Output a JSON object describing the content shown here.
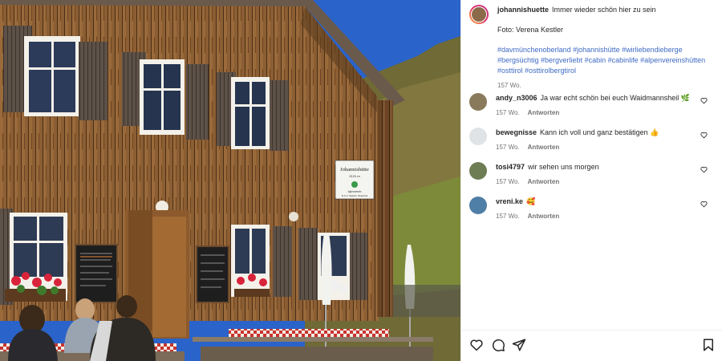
{
  "post": {
    "author": "johannishuette",
    "caption": "Immer wieder schön hier zu sein",
    "photo_credit": "Foto: Verena Kestler",
    "hashtags": "#davmünchenoberland #johannishütte #wirliebendieberge #bergsüchtig #bergverliebt #cabin #cabinlife #alpenvereinshütten #osttirol #osttirolbergtirol",
    "age": "157 Wo."
  },
  "photo": {
    "sign_title": "Johannishütte",
    "sign_subtitle": "2121 m",
    "sign_line1": "Alpenverein",
    "sign_line2": "D.A.V. Sektion Oberland"
  },
  "comments": [
    {
      "user": "andy_n3006",
      "text": "Ja war echt schön bei euch Waidmannsheil 🌿",
      "age": "157 Wo.",
      "reply": "Antworten",
      "avatar_color": "#8a7a5c"
    },
    {
      "user": "bewegnisse",
      "text": "Kann ich voll und ganz bestätigen 👍",
      "age": "157 Wo.",
      "reply": "Antworten",
      "avatar_color": "#dfe3e6"
    },
    {
      "user": "tosi4797",
      "text": "wir sehen uns morgen",
      "age": "157 Wo.",
      "reply": "Antworten",
      "avatar_color": "#6f7d55"
    },
    {
      "user": "vreni.ke",
      "text": "🥰",
      "age": "157 Wo.",
      "reply": "Antworten",
      "avatar_color": "#4f7ea6"
    }
  ],
  "icons": {
    "like": "heart-icon",
    "comment": "comment-icon",
    "share": "share-icon",
    "save": "bookmark-icon"
  },
  "colors": {
    "hashtag": "#3f6bc4",
    "muted": "#737373",
    "sky": "#2a63c9"
  }
}
